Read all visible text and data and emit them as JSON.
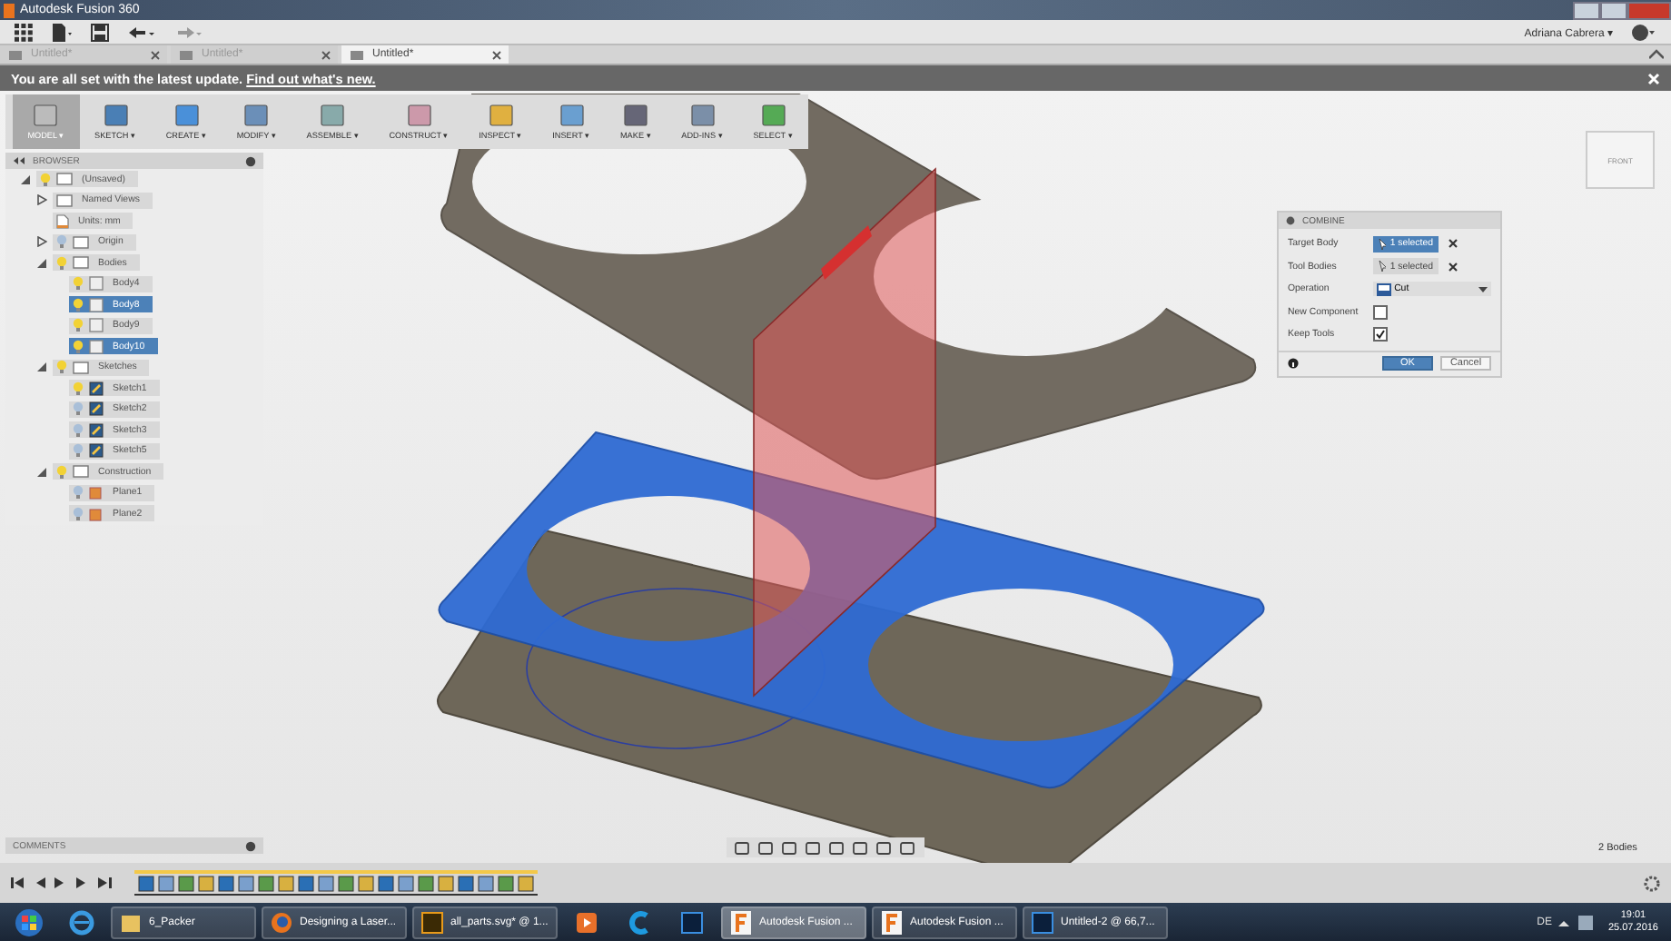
{
  "window": {
    "title": "Autodesk Fusion 360",
    "user": "Adriana Cabrera ▾"
  },
  "tabs": [
    {
      "label": "Untitled*",
      "selected": false
    },
    {
      "label": "Untitled*",
      "selected": false
    },
    {
      "label": "Untitled*",
      "selected": true
    }
  ],
  "notification": {
    "text": "You are all set with the latest update.",
    "link": "Find out what's new."
  },
  "toolbar": [
    {
      "label": "MODEL ▾",
      "selected": true
    },
    {
      "label": "SKETCH ▾",
      "selected": false
    },
    {
      "label": "CREATE ▾",
      "selected": false
    },
    {
      "label": "MODIFY ▾",
      "selected": false
    },
    {
      "label": "ASSEMBLE ▾",
      "selected": false
    },
    {
      "label": "CONSTRUCT ▾",
      "selected": false
    },
    {
      "label": "INSPECT ▾",
      "selected": false
    },
    {
      "label": "INSERT ▾",
      "selected": false
    },
    {
      "label": "MAKE ▾",
      "selected": false
    },
    {
      "label": "ADD-INS ▾",
      "selected": false
    },
    {
      "label": "SELECT ▾",
      "selected": false
    }
  ],
  "browser": {
    "title": "BROWSER",
    "tree": [
      {
        "label": "(Unsaved)",
        "kind": "document",
        "visible": true,
        "expanded": true,
        "selected": false,
        "children": [
          {
            "label": "Named Views",
            "kind": "folder",
            "expanded": false,
            "selected": false
          },
          {
            "label": "Units: mm",
            "kind": "units",
            "selected": false
          },
          {
            "label": "Origin",
            "kind": "folder",
            "visible": false,
            "expanded": false,
            "selected": false
          },
          {
            "label": "Bodies",
            "kind": "folder",
            "visible": true,
            "expanded": true,
            "selected": false,
            "children": [
              {
                "label": "Body4",
                "kind": "body",
                "visible": true,
                "selected": false
              },
              {
                "label": "Body8",
                "kind": "body",
                "visible": true,
                "selected": true
              },
              {
                "label": "Body9",
                "kind": "body",
                "visible": true,
                "selected": false
              },
              {
                "label": "Body10",
                "kind": "body",
                "visible": true,
                "selected": true
              }
            ]
          },
          {
            "label": "Sketches",
            "kind": "folder",
            "visible": true,
            "expanded": true,
            "selected": false,
            "children": [
              {
                "label": "Sketch1",
                "kind": "sketch",
                "visible": true,
                "selected": false
              },
              {
                "label": "Sketch2",
                "kind": "sketch",
                "visible": false,
                "selected": false
              },
              {
                "label": "Sketch3",
                "kind": "sketch",
                "visible": false,
                "selected": false
              },
              {
                "label": "Sketch5",
                "kind": "sketch",
                "visible": false,
                "selected": false
              }
            ]
          },
          {
            "label": "Construction",
            "kind": "folder",
            "visible": true,
            "expanded": true,
            "selected": false,
            "children": [
              {
                "label": "Plane1",
                "kind": "plane",
                "visible": false,
                "selected": false
              },
              {
                "label": "Plane2",
                "kind": "plane",
                "visible": false,
                "selected": false
              }
            ]
          }
        ]
      }
    ]
  },
  "viewcube": {
    "label": "FRONT"
  },
  "combine": {
    "title": "COMBINE",
    "rows": [
      {
        "kind": "selection",
        "label": "Target Body",
        "value": "1 selected",
        "selected": true
      },
      {
        "kind": "selection",
        "label": "Tool Bodies",
        "value": "1 selected",
        "selected": false
      },
      {
        "kind": "dropdown",
        "label": "Operation",
        "value": "Cut"
      },
      {
        "kind": "checkbox",
        "label": "New Component",
        "checked": false
      },
      {
        "kind": "checkbox",
        "label": "Keep Tools",
        "checked": true
      }
    ],
    "buttons": [
      {
        "label": "OK",
        "primary": true
      },
      {
        "label": "Cancel",
        "primary": false
      }
    ]
  },
  "comments": {
    "title": "COMMENTS"
  },
  "status": {
    "text": "2 Bodies"
  },
  "taskbar": [
    {
      "kind": "start",
      "selected": false
    },
    {
      "kind": "ie",
      "selected": false
    },
    {
      "kind": "folder",
      "label": "6_Packer",
      "selected": false
    },
    {
      "kind": "firefox",
      "label": "Designing a Laser...",
      "selected": false
    },
    {
      "kind": "illustrator",
      "label": "all_parts.svg* @ 1...",
      "selected": false
    },
    {
      "kind": "media",
      "selected": false
    },
    {
      "kind": "c",
      "selected": false
    },
    {
      "kind": "photoshop",
      "selected": false
    },
    {
      "kind": "fusion",
      "label": "Autodesk Fusion ...",
      "selected": true
    },
    {
      "kind": "fusion",
      "label": "Autodesk Fusion ...",
      "selected": false
    },
    {
      "kind": "photoshop",
      "label": "Untitled-2 @ 66,7...",
      "selected": false
    }
  ],
  "tray": {
    "language": "DE",
    "time": "19:01",
    "date": "25.07.2016"
  }
}
